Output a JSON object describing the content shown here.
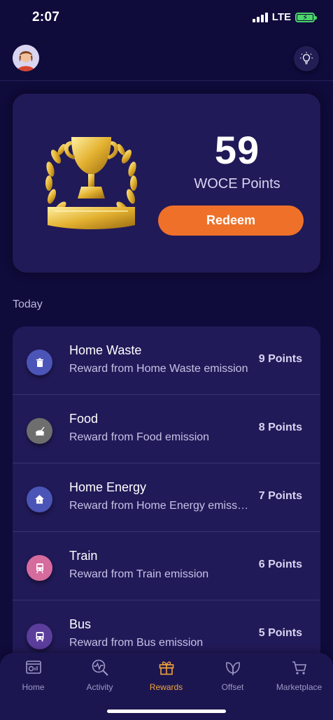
{
  "status_bar": {
    "time": "2:07",
    "network": "LTE"
  },
  "points_card": {
    "value": "59",
    "label": "WOCE Points",
    "redeem_label": "Redeem"
  },
  "section_label": "Today",
  "rewards": [
    {
      "title": "Home Waste",
      "description": "Reward from Home Waste emission",
      "points": "9 Points",
      "icon": "trash-icon",
      "color": "#4b55b8"
    },
    {
      "title": "Food",
      "description": "Reward from Food emission",
      "points": "8 Points",
      "icon": "food-icon",
      "color": "#6e6e6e"
    },
    {
      "title": "Home Energy",
      "description": "Reward from Home Energy emission",
      "points": "7 Points",
      "icon": "house-icon",
      "color": "#4b55b8"
    },
    {
      "title": "Train",
      "description": "Reward from Train emission",
      "points": "6 Points",
      "icon": "train-icon",
      "color": "#d66b9e"
    },
    {
      "title": "Bus",
      "description": "Reward from Bus emission",
      "points": "5 Points",
      "icon": "bus-icon",
      "color": "#5b3d9c"
    }
  ],
  "tabs": [
    {
      "label": "Home",
      "icon": "home-icon"
    },
    {
      "label": "Activity",
      "icon": "activity-icon"
    },
    {
      "label": "Rewards",
      "icon": "gift-icon",
      "active": true
    },
    {
      "label": "Offset",
      "icon": "leaf-icon"
    },
    {
      "label": "Marketplace",
      "icon": "cart-icon"
    }
  ],
  "colors": {
    "background": "#0f0b3b",
    "card": "#211a58",
    "accent": "#ef7129",
    "active_tab": "#f0a43c",
    "battery": "#4bd66b"
  }
}
